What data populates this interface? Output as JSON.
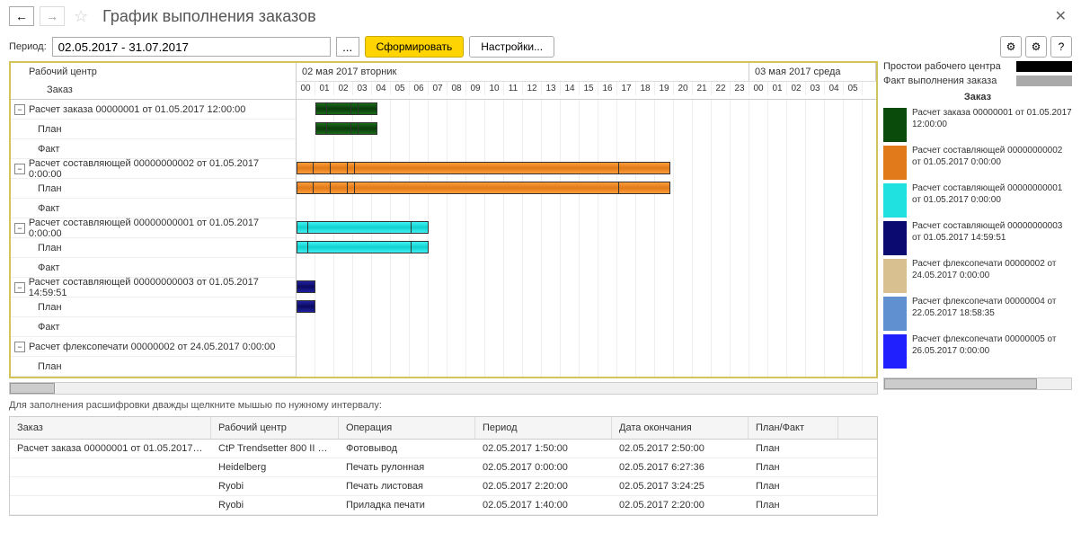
{
  "title": "График выполнения заказов",
  "period_label": "Период:",
  "period_value": "02.05.2017 - 31.07.2017",
  "generate_btn": "Сформировать",
  "settings_btn": "Настройки...",
  "tree_header1": "Рабочий центр",
  "tree_header2": "Заказ",
  "dates": [
    "02 мая 2017 вторник",
    "03 мая 2017 среда"
  ],
  "hours": [
    "00",
    "01",
    "02",
    "03",
    "04",
    "05",
    "06",
    "07",
    "08",
    "09",
    "10",
    "11",
    "12",
    "13",
    "14",
    "15",
    "16",
    "17",
    "18",
    "19",
    "20",
    "21",
    "22",
    "23",
    "00",
    "01",
    "02",
    "03",
    "04",
    "05"
  ],
  "rows": [
    {
      "label": "Расчет заказа 00000001 от 01.05.2017 12:00:00",
      "expand": true,
      "child": false
    },
    {
      "label": "План",
      "child": true
    },
    {
      "label": "Факт",
      "child": true
    },
    {
      "label": "Расчет составляющей 00000000002 от 01.05.2017 0:00:00",
      "expand": true,
      "child": false
    },
    {
      "label": "План",
      "child": true
    },
    {
      "label": "Факт",
      "child": true
    },
    {
      "label": "Расчет составляющей 00000000001 от 01.05.2017 0:00:00",
      "expand": true,
      "child": false
    },
    {
      "label": "План",
      "child": true
    },
    {
      "label": "Факт",
      "child": true
    },
    {
      "label": "Расчет составляющей 00000000003 от 01.05.2017 14:59:51",
      "expand": true,
      "child": false
    },
    {
      "label": "План",
      "child": true
    },
    {
      "label": "Факт",
      "child": true
    },
    {
      "label": "Расчет флексопечати 00000002 от 24.05.2017 0:00:00",
      "expand": true,
      "child": false
    },
    {
      "label": "План",
      "child": true
    }
  ],
  "chart_data": {
    "type": "gantt",
    "time_unit": "hours from 02.05.2017 00:00",
    "bars": [
      {
        "row": 0,
        "start": 1,
        "end": 4.3,
        "color": "green",
        "segments": [
          1.5,
          2.8,
          3.2
        ]
      },
      {
        "row": 1,
        "start": 1,
        "end": 4.3,
        "color": "green",
        "segments": [
          1.5,
          2.8,
          3.2
        ]
      },
      {
        "row": 3,
        "start": 0,
        "end": 19.8,
        "color": "orange",
        "segments": [
          0.8,
          1.7,
          2.6,
          3.0,
          17.0
        ]
      },
      {
        "row": 4,
        "start": 0,
        "end": 19.8,
        "color": "orange",
        "segments": [
          0.8,
          1.7,
          2.6,
          3.0,
          17.0
        ]
      },
      {
        "row": 6,
        "start": 0,
        "end": 7,
        "color": "cyan",
        "segments": [
          0.5,
          6.0
        ]
      },
      {
        "row": 7,
        "start": 0,
        "end": 7,
        "color": "cyan",
        "segments": [
          0.5,
          6.0
        ]
      },
      {
        "row": 9,
        "start": 0,
        "end": 1,
        "color": "navy"
      },
      {
        "row": 10,
        "start": 0,
        "end": 1,
        "color": "navy"
      }
    ]
  },
  "hint": "Для заполнения расшифровки дважды щелкните мышью по нужному интервалу:",
  "detail_cols": [
    "Заказ",
    "Рабочий центр",
    "Операция",
    "Период",
    "Дата окончания",
    "План/Факт"
  ],
  "detail_rows": [
    [
      "Расчет заказа 00000001 от 01.05.2017 1...",
      "CtP Trendsetter 800 II Qu...",
      "Фотовывод",
      "02.05.2017 1:50:00",
      "02.05.2017 2:50:00",
      "План"
    ],
    [
      "",
      "Heidelberg",
      "Печать рулонная",
      "02.05.2017 0:00:00",
      "02.05.2017 6:27:36",
      "План"
    ],
    [
      "",
      "Ryobi",
      "Печать листовая",
      "02.05.2017 2:20:00",
      "02.05.2017 3:24:25",
      "План"
    ],
    [
      "",
      "Ryobi",
      "Приладка печати",
      "02.05.2017 1:40:00",
      "02.05.2017 2:20:00",
      "План"
    ]
  ],
  "legend_top": [
    {
      "label": "Простои рабочего центра",
      "class": "sw-black"
    },
    {
      "label": "Факт выполнения заказа",
      "class": "sw-gray"
    }
  ],
  "legend_title": "Заказ",
  "legend_items": [
    {
      "class": "sq-dgreen",
      "text": "Расчет заказа 00000001 от 01.05.2017 12:00:00"
    },
    {
      "class": "sq-orange",
      "text": "Расчет составляющей 00000000002 от 01.05.2017 0:00:00"
    },
    {
      "class": "sq-cyan",
      "text": "Расчет составляющей 00000000001 от 01.05.2017 0:00:00"
    },
    {
      "class": "sq-navy",
      "text": "Расчет составляющей 00000000003 от 01.05.2017 14:59:51"
    },
    {
      "class": "sq-tan",
      "text": "Расчет флексопечати 00000002 от 24.05.2017 0:00:00"
    },
    {
      "class": "sq-lblue",
      "text": "Расчет флексопечати 00000004 от 22.05.2017 18:58:35"
    },
    {
      "class": "sq-blue",
      "text": "Расчет флексопечати 00000005 от 26.05.2017 0:00:00"
    }
  ]
}
